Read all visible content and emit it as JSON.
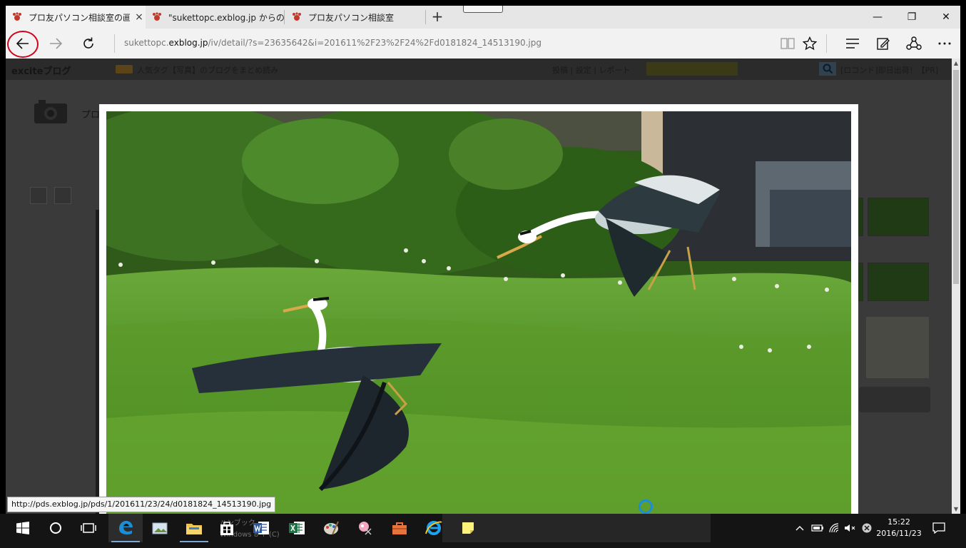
{
  "browser": {
    "tabs": [
      {
        "label": "プロ友パソコン相談室の画",
        "close_glyph": "×"
      },
      {
        "label": "\"sukettopc.exblog.jp からの"
      },
      {
        "label": "プロ友パソコン相談室"
      }
    ],
    "new_tab_glyph": "+",
    "window_controls": {
      "minimize": "—",
      "restore": "❐",
      "close": "✕"
    },
    "address": {
      "scheme_prefix": "sukettopc.",
      "host": "exblog.jp",
      "path": "/iv/detail/?s=23635642&i=201611%2F23%2F24%2Fd0181824_14513190.jpg"
    }
  },
  "blog": {
    "logo": "exciteブログ",
    "popular_tags": "人気タグ【写真】のブログをまとめ読み",
    "links": "投稿 | 設定 | レポート",
    "pr_text": "[ロコンド]即日出荷！【PR]",
    "title_fragment": "プロ"
  },
  "status_url": "http://pds.exblog.jp/pds/1/201611/23/24/d0181824_14513190.jpg",
  "taskbar": {
    "ghost_text": "ハンブック",
    "ghost_sub": "Windows 8 ↑ (C)",
    "clock_time": "15:22",
    "clock_date": "2016/11/23"
  },
  "colors": {
    "highlight_circle": "#d0021b",
    "edge_blue": "#1a8fd6",
    "grass_green": "#5c9a2a"
  },
  "icons": [
    "back-arrow-icon",
    "forward-arrow-icon",
    "refresh-icon",
    "reading-view-icon",
    "favorite-star-icon",
    "hub-icon",
    "web-note-icon",
    "share-icon",
    "more-icon"
  ]
}
